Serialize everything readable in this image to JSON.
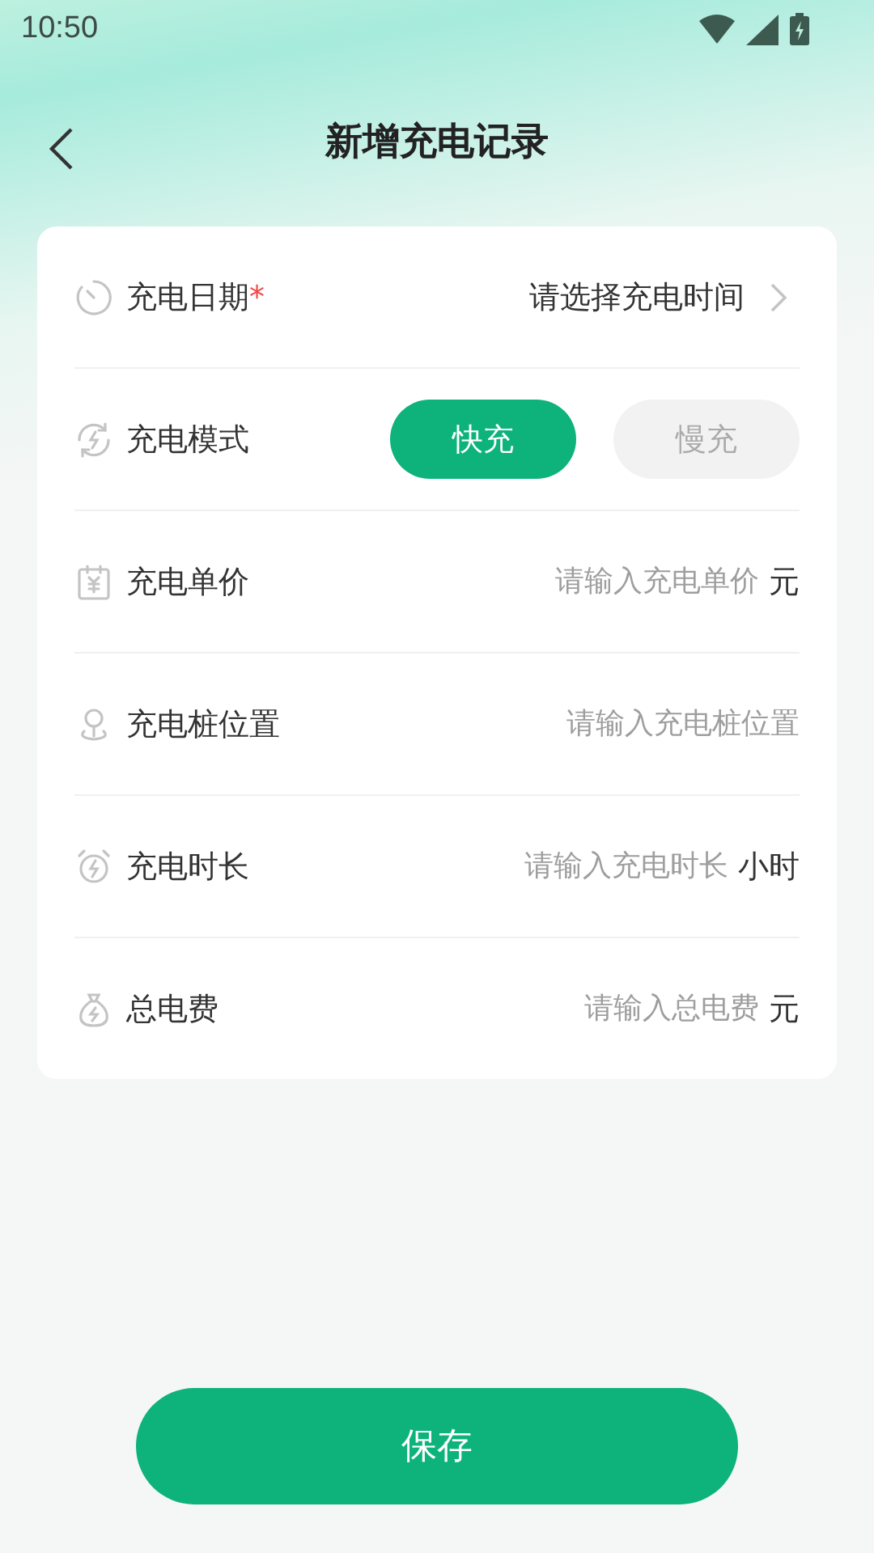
{
  "status_bar": {
    "time": "10:50"
  },
  "header": {
    "title": "新增充电记录"
  },
  "rows": [
    {
      "kind": "picker",
      "label": "充电日期",
      "required_mark": "*",
      "value": "请选择充电时间"
    },
    {
      "kind": "toggle",
      "label": "充电模式",
      "options": [
        {
          "label": "快充",
          "selected": true
        },
        {
          "label": "慢充",
          "selected": false
        }
      ]
    },
    {
      "kind": "input",
      "label": "充电单价",
      "placeholder": "请输入充电单价",
      "unit": "元"
    },
    {
      "kind": "input",
      "label": "充电桩位置",
      "placeholder": "请输入充电桩位置"
    },
    {
      "kind": "input",
      "label": "充电时长",
      "placeholder": "请输入充电时长",
      "unit": "小时"
    },
    {
      "kind": "input",
      "label": "总电费",
      "placeholder": "请输入总电费",
      "unit": "元"
    }
  ],
  "save_button": "保存"
}
